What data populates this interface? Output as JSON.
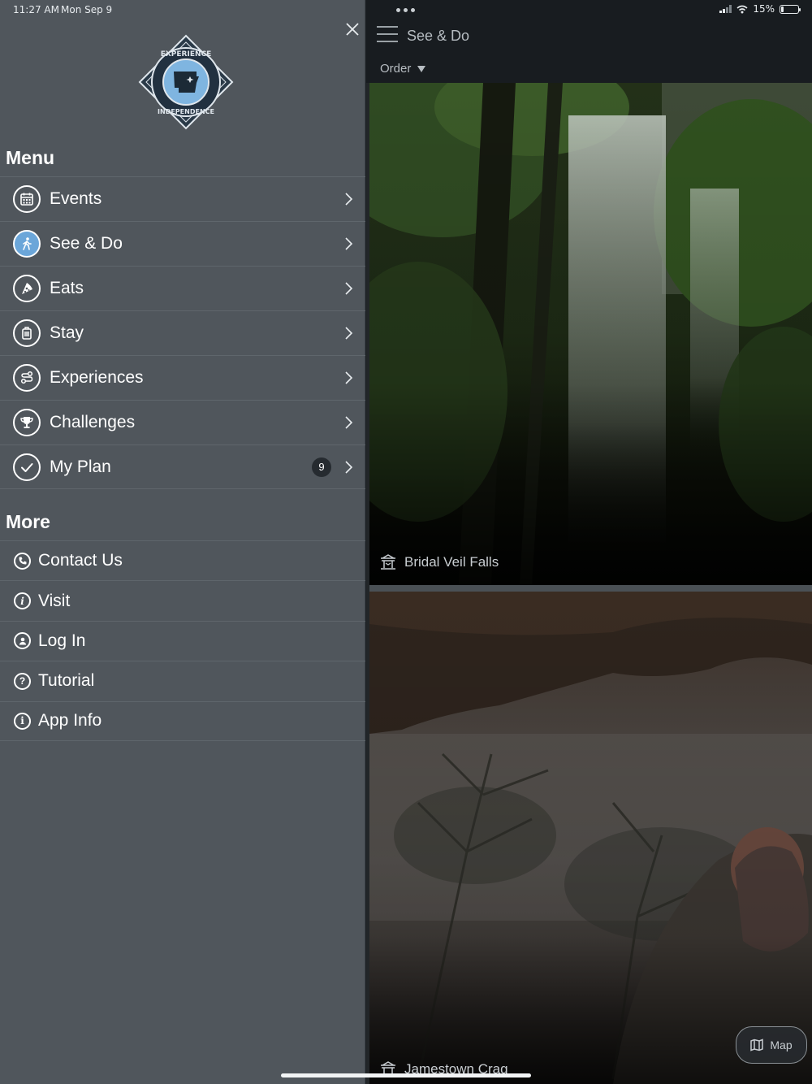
{
  "status": {
    "time": "11:27 AM",
    "date": "Mon Sep 9",
    "battery": "15%",
    "battery_level": 0.15
  },
  "drawer": {
    "menu_title": "Menu",
    "menu_items": [
      {
        "label": "Events",
        "icon": "calendar-icon"
      },
      {
        "label": "See & Do",
        "icon": "person-walking-icon",
        "active": true
      },
      {
        "label": "Eats",
        "icon": "pizza-icon"
      },
      {
        "label": "Stay",
        "icon": "luggage-icon"
      },
      {
        "label": "Experiences",
        "icon": "route-icon"
      },
      {
        "label": "Challenges",
        "icon": "trophy-icon"
      },
      {
        "label": "My Plan",
        "icon": "check-circle-icon",
        "badge": "9"
      }
    ],
    "more_title": "More",
    "more_items": [
      {
        "label": "Contact Us",
        "icon": "phone-icon"
      },
      {
        "label": "Visit",
        "icon": "info-icon"
      },
      {
        "label": "Log In",
        "icon": "user-icon"
      },
      {
        "label": "Tutorial",
        "icon": "question-icon"
      },
      {
        "label": "App Info",
        "icon": "info-circle-icon"
      }
    ],
    "logo_text_top": "EXPERIENCE",
    "logo_text_bottom": "INDEPENDENCE"
  },
  "content": {
    "title": "See & Do",
    "order_label": "Order",
    "cards": [
      {
        "name": "Bridal Veil Falls",
        "icon": "attraction-icon"
      },
      {
        "name": "Jamestown Crag",
        "icon": "attraction-icon"
      }
    ],
    "map_label": "Map"
  },
  "colors": {
    "drawer_bg": "#50565c",
    "header_bg": "#181c20",
    "active_icon": "#6ba6d9",
    "logo_blue": "#7fb5e0"
  }
}
